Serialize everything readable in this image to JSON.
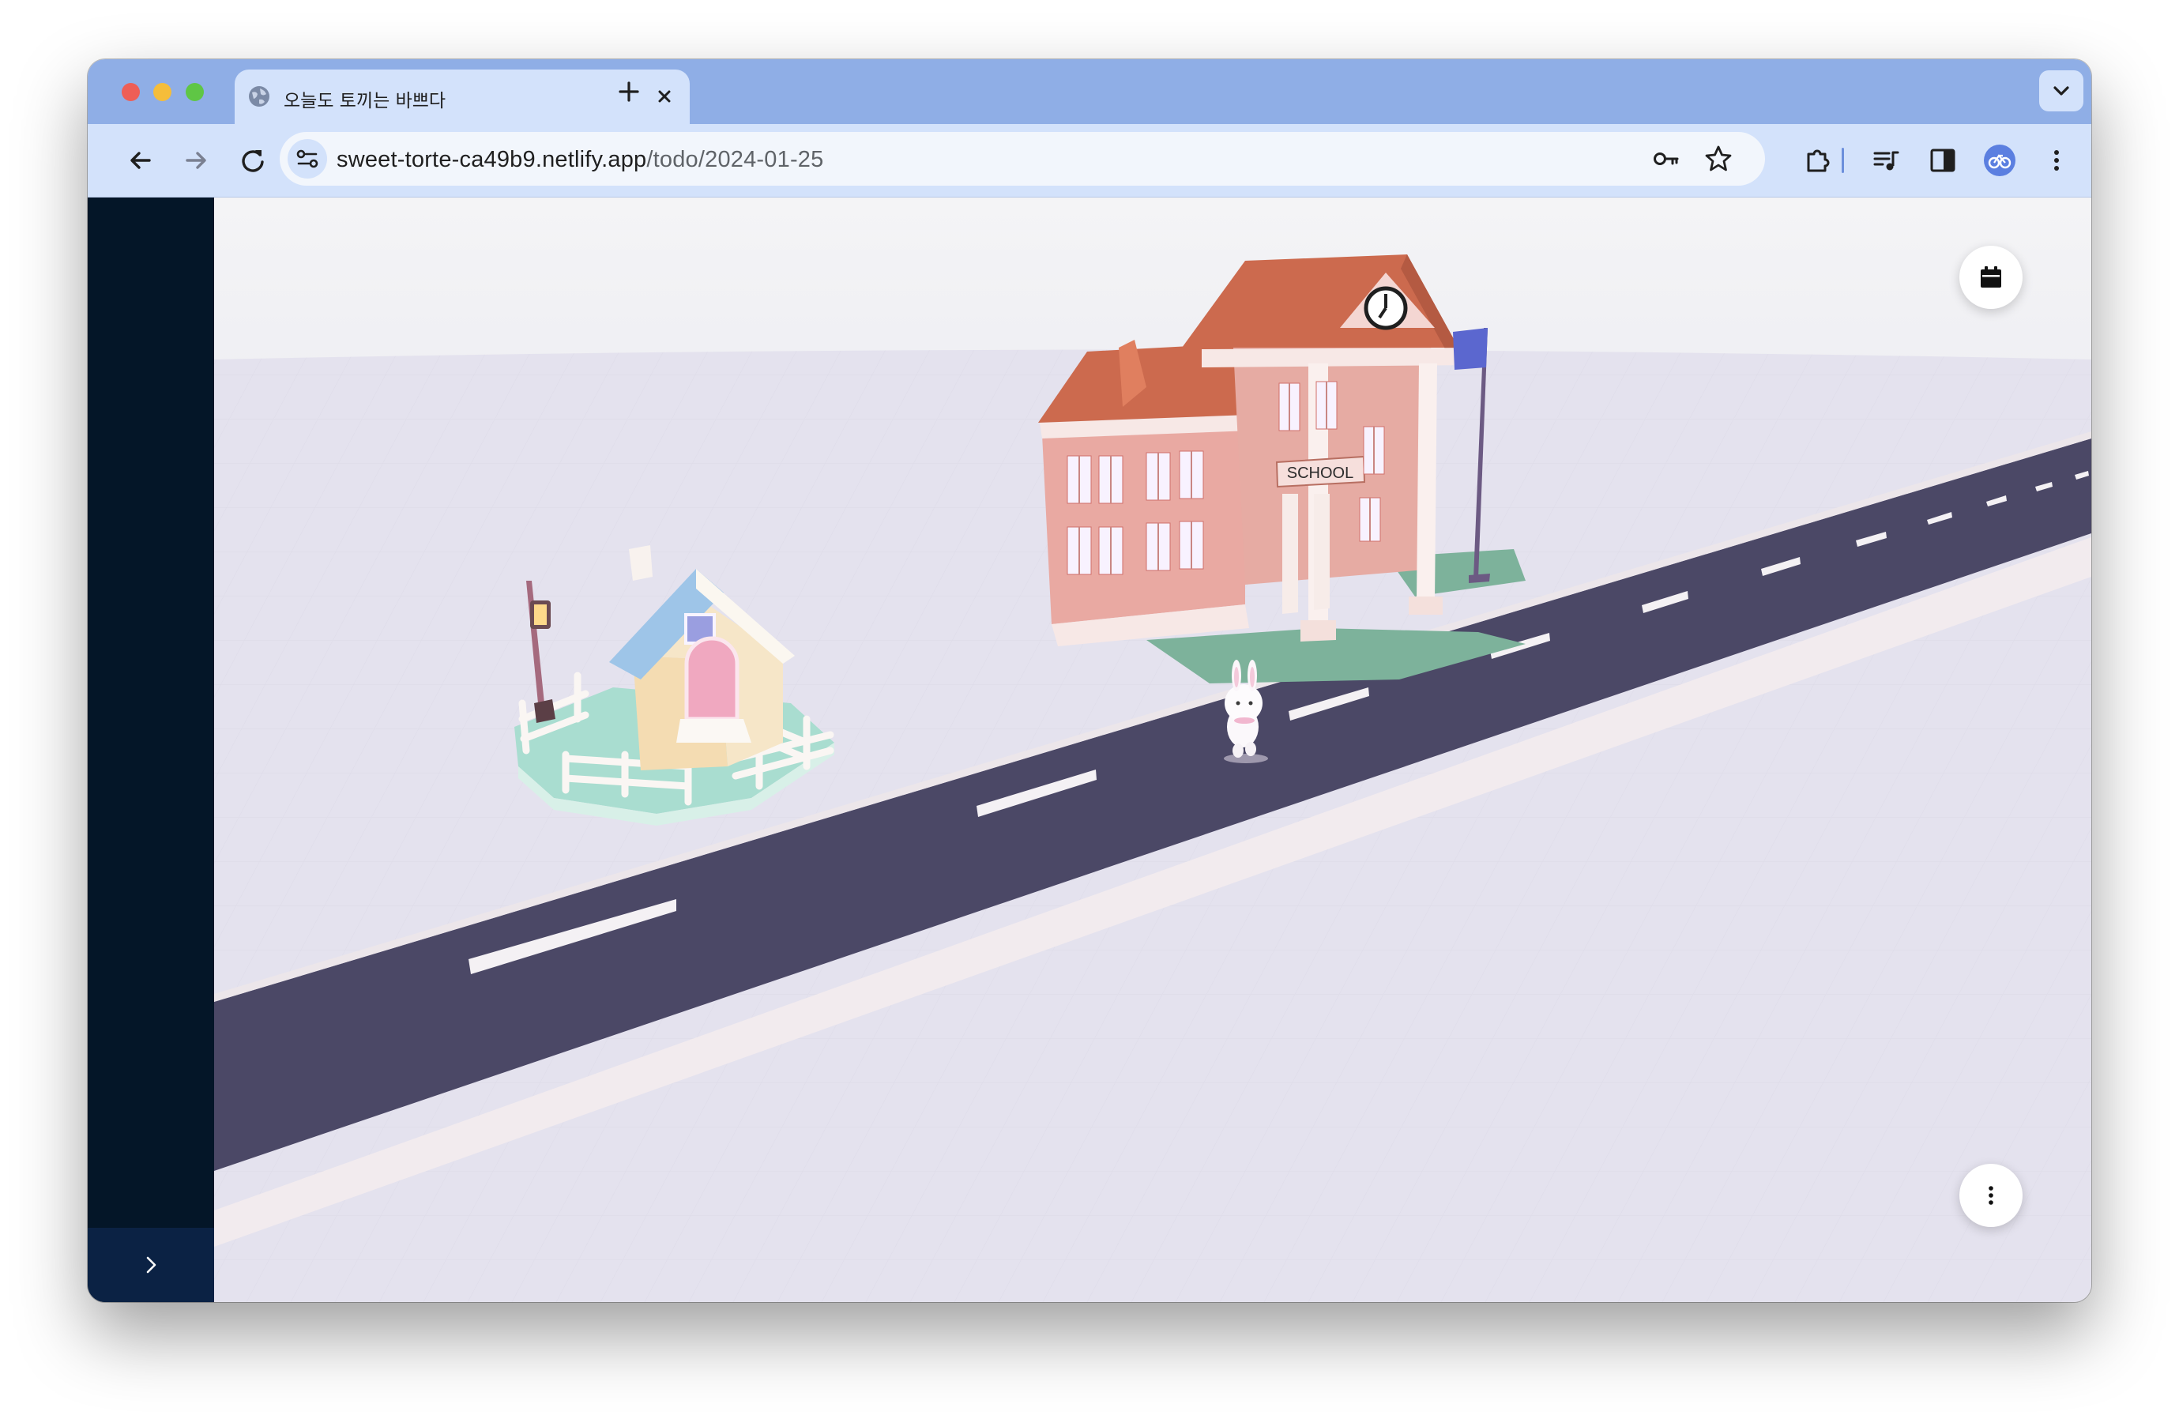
{
  "browser": {
    "tab": {
      "title": "오늘도 토끼는 바쁘다",
      "favicon": "globe-icon"
    },
    "url": {
      "host": "sweet-torte-ca49b9.netlify.app",
      "path": "/todo/2024-01-25"
    },
    "icons": {
      "back": "arrow-left-icon",
      "forward": "arrow-right-icon",
      "reload": "reload-icon",
      "site_info": "tune-icon",
      "password": "key-icon",
      "bookmark": "star-icon",
      "extensions": "puzzle-icon",
      "media": "queue-music-icon",
      "side_panel": "side-panel-icon",
      "profile": "profile-avatar-icon",
      "menu": "more-vertical-icon"
    }
  },
  "scene": {
    "school_sign": "SCHOOL",
    "colors": {
      "road": "#4b4866",
      "ground": "#e4e2ee",
      "school_wall": "#e6aba3",
      "school_roof": "#cc6a4e",
      "house_wall": "#f4dcb2",
      "house_roof": "#9ec5e8",
      "lawn": "#b5e3d6",
      "flag": "#5b67cf"
    }
  },
  "sidebar": {
    "toggle_icon": "chevron-right-icon"
  },
  "controls": {
    "calendar": "calendar-icon",
    "more": "more-vertical-icon"
  }
}
